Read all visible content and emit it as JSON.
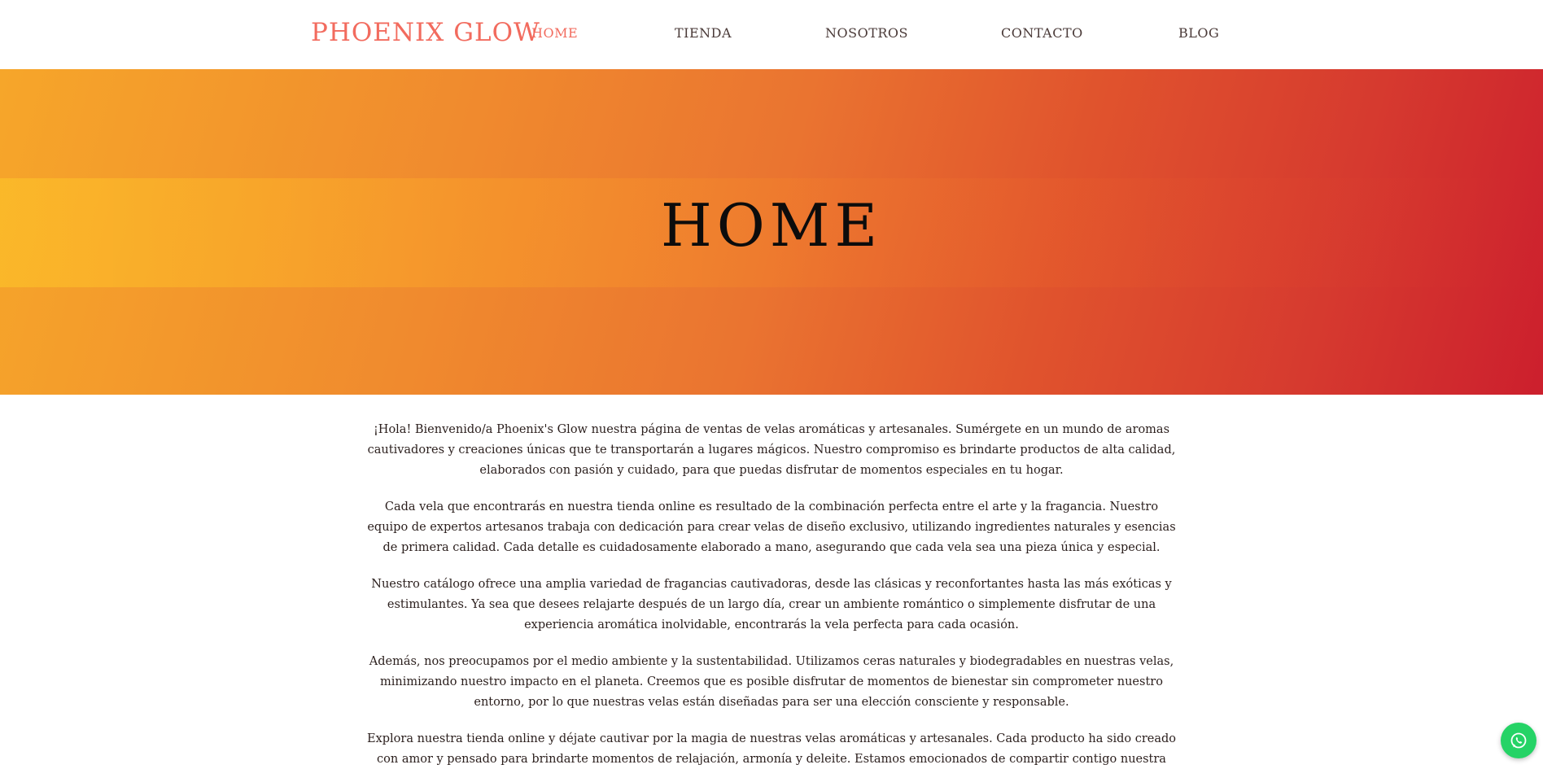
{
  "header": {
    "logo": "PHOENIX GLOW",
    "nav": [
      {
        "label": "HOME",
        "active": true
      },
      {
        "label": "TIENDA",
        "active": false
      },
      {
        "label": "NOSOTROS",
        "active": false
      },
      {
        "label": "CONTACTO",
        "active": false
      },
      {
        "label": "BLOG",
        "active": false
      }
    ]
  },
  "hero": {
    "title": "HOME"
  },
  "content": {
    "paragraphs": [
      "¡Hola! Bienvenido/a Phoenix's Glow nuestra página de ventas de velas aromáticas y artesanales. Sumérgete en un mundo de aromas cautivadores y creaciones únicas que te transportarán a lugares mágicos. Nuestro compromiso es brindarte productos de alta calidad, elaborados con pasión y cuidado, para que puedas disfrutar de momentos especiales en tu hogar.",
      "Cada vela que encontrarás en nuestra tienda online es resultado de la combinación perfecta entre el arte y la fragancia. Nuestro equipo de expertos artesanos trabaja con dedicación para crear velas de diseño exclusivo, utilizando ingredientes naturales y esencias de primera calidad. Cada detalle es cuidadosamente elaborado a mano, asegurando que cada vela sea una pieza única y especial.",
      "Nuestro catálogo ofrece una amplia variedad de fragancias cautivadoras, desde las clásicas y reconfortantes hasta las más exóticas y estimulantes. Ya sea que desees relajarte después de un largo día, crear un ambiente romántico o simplemente disfrutar de una experiencia aromática inolvidable, encontrarás la vela perfecta para cada ocasión.",
      "Además, nos preocupamos por el medio ambiente y la sustentabilidad. Utilizamos ceras naturales y biodegradables en nuestras velas, minimizando nuestro impacto en el planeta. Creemos que es posible disfrutar de momentos de bienestar sin comprometer nuestro entorno, por lo que nuestras velas están diseñadas para ser una elección consciente y responsable.",
      "Explora nuestra tienda online y déjate cautivar por la magia de nuestras velas aromáticas y artesanales. Cada producto ha sido creado con amor y pensado para brindarte momentos de relajación, armonía y deleite. Estamos emocionados de compartir contigo nuestra pasión por las velas y esperamos que"
    ]
  },
  "colors": {
    "accent": "#f26b5e",
    "nav_text": "#4a3a38",
    "hero_gradient_start": "#f6a62a",
    "hero_gradient_end": "#cc1f2d",
    "whatsapp": "#25d366"
  },
  "floating": {
    "icon": "whatsapp-icon"
  }
}
